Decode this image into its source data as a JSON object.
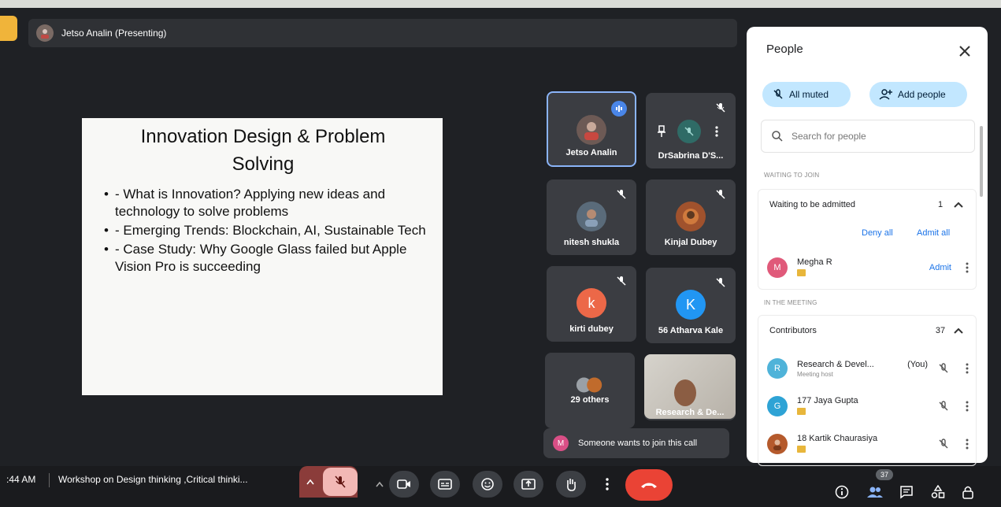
{
  "presenting": {
    "label": "Jetso Analin (Presenting)"
  },
  "slide": {
    "title": "Innovation Design & Problem Solving",
    "bullets": [
      "- What is Innovation? Applying new ideas and technology to solve problems",
      "- Emerging Trends: Blockchain, AI, Sustainable Tech",
      "- Case Study: Why Google Glass failed but Apple Vision Pro is succeeding"
    ]
  },
  "tiles": [
    {
      "name": "Jetso Analin",
      "initial": "",
      "color": "#6d5a55"
    },
    {
      "name": "DrSabrina D'S...",
      "initial": "",
      "color": "#2f6b66"
    },
    {
      "name": "nitesh shukla",
      "initial": "",
      "color": "#5a6b7a"
    },
    {
      "name": "Kinjal Dubey",
      "initial": "",
      "color": "#a0522d"
    },
    {
      "name": "kirti dubey",
      "initial": "k",
      "color": "#ec6848"
    },
    {
      "name": "56 Atharva Kale",
      "initial": "K",
      "color": "#2196f3"
    },
    {
      "name": "29 others",
      "initial": "",
      "color": "#7c7f86"
    },
    {
      "name": "Research & De...",
      "initial": "",
      "color": "#b7b1a8"
    }
  ],
  "toast": {
    "initial": "M",
    "text": "Someone wants to join this call"
  },
  "panel": {
    "title": "People",
    "all_muted": "All muted",
    "add_people": "Add people",
    "search_placeholder": "Search for people",
    "waiting_label": "WAITING TO JOIN",
    "waiting_group": "Waiting to be admitted",
    "waiting_count": "1",
    "deny_all": "Deny all",
    "admit_all": "Admit all",
    "waiting_person": {
      "initial": "M",
      "name": "Megha R",
      "action": "Admit"
    },
    "meeting_label": "IN THE MEETING",
    "contributors": "Contributors",
    "contributors_count": "37",
    "people": [
      {
        "initial": "R",
        "name": "Research & Devel...",
        "you": "(You)",
        "sub": "Meeting host",
        "color": "#4fb3d9"
      },
      {
        "initial": "G",
        "name": "177 Jaya Gupta",
        "you": "",
        "sub": "",
        "color": "#2ea3d5"
      },
      {
        "initial": "",
        "name": "18 Kartik Chaurasiya",
        "you": "",
        "sub": "",
        "color": "#b55a2c"
      }
    ]
  },
  "bottom": {
    "time": ":44 AM",
    "meeting": "Workshop on Design thinking ,Critical thinki...",
    "people_count": "37"
  }
}
